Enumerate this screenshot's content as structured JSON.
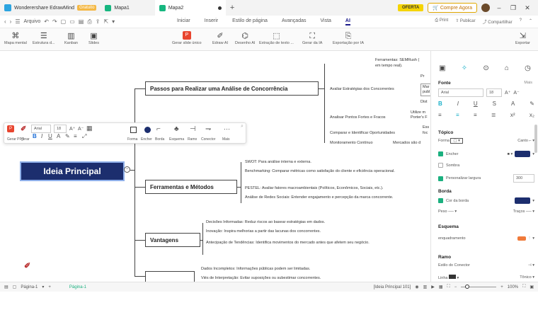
{
  "titlebar": {
    "app_name": "Wonderershare EdrawMind",
    "app_badge": "Gratuito",
    "tabs": [
      {
        "label": "Mapa1"
      },
      {
        "label": "Mapa2"
      }
    ],
    "promo_text": "OFERTA",
    "buy_label": "Compre Agora"
  },
  "menubar": {
    "file_label": "Arquivo",
    "items": [
      "Iniciar",
      "Inserir",
      "Estilo de página",
      "Avançadas",
      "Vista",
      "AI"
    ],
    "active": "AI",
    "right_items": [
      "Print",
      "Publicar",
      "Compartilhar"
    ]
  },
  "ribbon": {
    "left": [
      {
        "label": "Mapa mental"
      },
      {
        "label": "Estrutura d..."
      },
      {
        "label": "Kanban"
      },
      {
        "label": "Slides"
      }
    ],
    "center": [
      {
        "label": "Gerar slide único"
      },
      {
        "label": "Edraw AI"
      },
      {
        "label": "Desenho AI"
      },
      {
        "label": "Extração de texto ..."
      },
      {
        "label": "Gerar da IA"
      },
      {
        "label": "Exportação por IA"
      }
    ],
    "export_label": "Exportar"
  },
  "map": {
    "main_topic": "Ideia Principal",
    "topics": [
      {
        "label": "Passos para Realizar uma Análise de Concorrência",
        "subs": [
          "Avaliar Estratégias dos Concorrentes",
          "Analisar Pontos Fortes e Fracos",
          "Comparar e Identificar Oportunidades",
          "Monitoramento Contínuo"
        ],
        "partial": [
          "Ferramentas: SEMRush (",
          "em tempo real).",
          "Pr",
          "Mar",
          "publ",
          "Dist",
          "Utilize m",
          "Porter's F",
          "Ess",
          "foc",
          "Mercados são d"
        ]
      },
      {
        "label": "Ferramentas e Métodos",
        "subs": [
          "SWOT: Para análise interna e externa.",
          "Benchmarking: Comparar métricas como satisfação do cliente e eficiência operacional.",
          "PESTEL: Avaliar fatores macroambientais (Políticos, Econômicos, Sociais, etc.).",
          "Análise de Redes Sociais: Entender engajamento e percepção da marca concorrente."
        ]
      },
      {
        "label": "Vantagens",
        "subs": [
          "Decisões Informadas: Reduz riscos ao basear estratégias em dados.",
          "Inovação: Inspira melhorias a partir das lacunas dos concorrentes.",
          "Antecipação de Tendências: Identifica movimentos do mercado antes que afetem seu negócio."
        ]
      },
      {
        "label": "",
        "subs": [
          "Dados Incompletos: Informações públicas podem ser limitadas.",
          "Viés de Interpretação: Evitar suposições ou subestimar concorrentes."
        ]
      }
    ]
  },
  "float_toolbar": {
    "font": "Arial",
    "size": "18",
    "labels": [
      "Gerar PPT",
      "gerar",
      "Forma",
      "Encher",
      "Borda",
      "Esquema",
      "Ramo",
      "Conector",
      "Mais"
    ]
  },
  "panel": {
    "fonte_title": "Fonte",
    "mais_label": "Mais",
    "font": "Arial",
    "font_size": "18",
    "topico_title": "Tópico",
    "forma_label": "Forma",
    "canto_label": "Canto",
    "encher_label": "Encher",
    "sombra_label": "Sombra",
    "personalizar_label": "Personalizar largura",
    "largura_value": "300",
    "borda_title": "Borda",
    "cor_borda_label": "Cor da borda",
    "peso_label": "Peso",
    "tracos_label": "Traços",
    "esquema_title": "Esquema",
    "enquadramento_label": "enquadramento",
    "ramo_title": "Ramo",
    "estilo_conector_label": "Estilo do Conector",
    "linha_label": "Linha",
    "tonico_label": "Tônico",
    "accent": "#1c2e6e"
  },
  "statusbar": {
    "page_label": "Página-1",
    "page_tab": "Página-1",
    "selection": "[Ideia Principal 101]",
    "zoom": "100%"
  }
}
